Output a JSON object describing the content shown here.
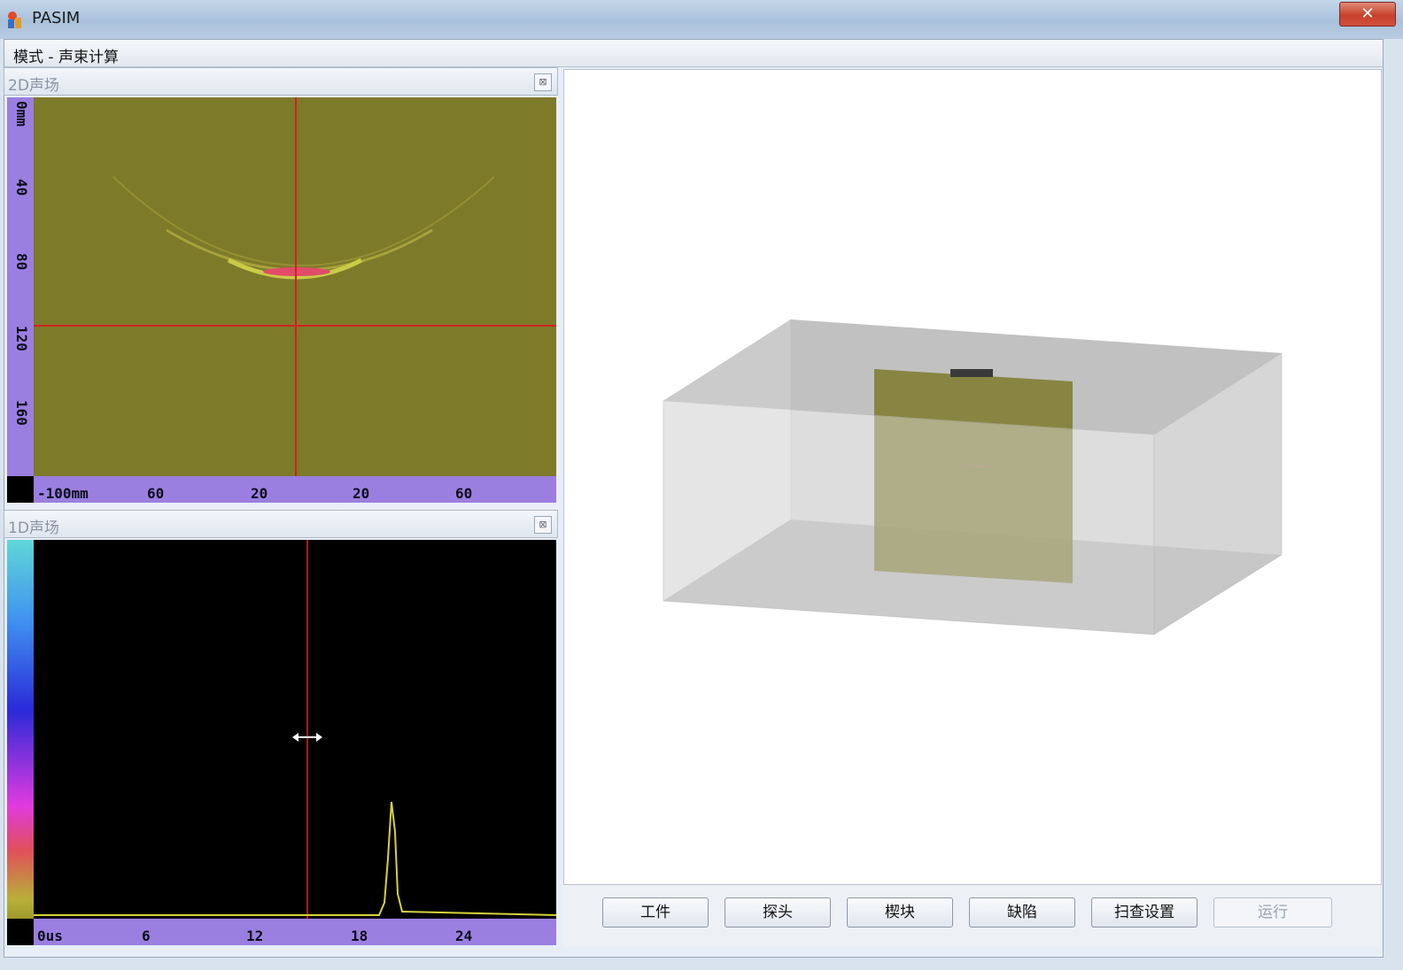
{
  "window": {
    "title": "PASIM",
    "close_glyph": "✕"
  },
  "mode": {
    "label": "模式 - 声束计算"
  },
  "panel_2d": {
    "title": "2D声场",
    "close_glyph": "⊠",
    "vruler_labels": [
      "0mm",
      "40",
      "80",
      "120",
      "160"
    ],
    "hruler_labels": [
      "-100mm",
      "60",
      "20",
      "20",
      "60"
    ]
  },
  "panel_1d": {
    "title": "1D声场",
    "close_glyph": "⊠",
    "hruler_labels": [
      "0us",
      "6",
      "12",
      "18",
      "24"
    ]
  },
  "buttons": {
    "workpiece": "工件",
    "probe": "探头",
    "wedge": "楔块",
    "defect": "缺陷",
    "scan_settings": "扫查设置",
    "run": "运行"
  },
  "colors": {
    "field_bg": "#7d7a2a",
    "cursor_line": "#d2231c",
    "ruler": "#9b7fe0",
    "signal": "#d7d23a"
  }
}
